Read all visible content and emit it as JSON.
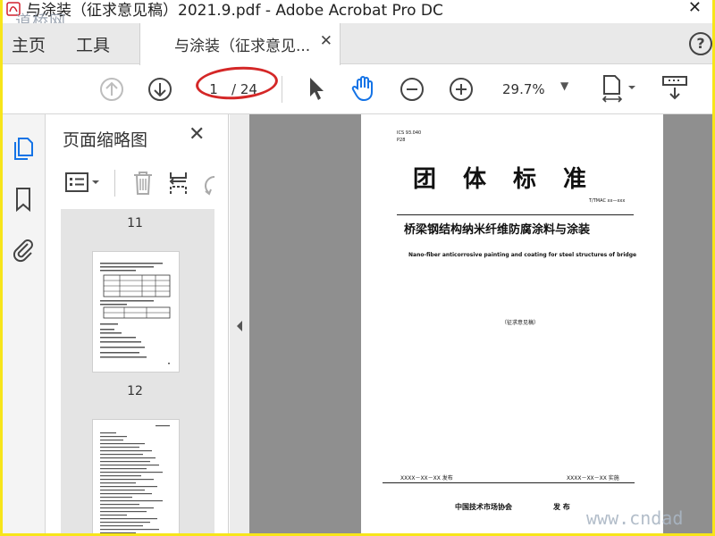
{
  "window": {
    "title": "与涂装（征求意见稿）2021.9.pdf - Adobe Acrobat Pro DC",
    "close_glyph": "✕",
    "watermark_top": "道桥网",
    "watermark_bottom": "www.cndad"
  },
  "tabs": {
    "home": "主页",
    "tools": "工具",
    "document": "与涂装（征求意见...",
    "close": "✕",
    "help": "?"
  },
  "toolbar": {
    "current_page": "1",
    "total_pages": "/ 24",
    "zoom": "29.7%",
    "zoom_caret": "▼"
  },
  "panel": {
    "title": "页面缩略图",
    "close": "✕",
    "thumbnails": [
      {
        "label": "11"
      },
      {
        "label": "12"
      }
    ]
  },
  "document": {
    "ics": "ICS 93.040",
    "pcode": "P28",
    "standard_type": "团体标准",
    "standard_no": "T/TMAC xx—xxx",
    "title_cn": "桥梁钢结构纳米纤维防腐涂料与涂装",
    "title_en": "Nano-fiber anticorrosive painting and coating for steel structures of bridge",
    "draft_note": "（征求意见稿）",
    "issue_date": "XXXX－XX－XX 发布",
    "implement_date": "XXXX－XX－XX 实施",
    "organization": "中国技术市场协会",
    "publish": "发 布"
  },
  "colors": {
    "accent": "#1473e6",
    "annotation_oval": "#d42727",
    "outer_frame": "#f7e51a",
    "document_area": "#8f8f8f"
  },
  "icons": [
    "acrobat-logo-icon",
    "arrow-up-icon",
    "arrow-down-icon",
    "select-cursor-icon",
    "hand-tool-icon",
    "zoom-out-icon",
    "zoom-in-icon",
    "fit-page-icon",
    "scroll-mode-icon",
    "page-thumbnails-icon",
    "bookmark-icon",
    "attachment-icon",
    "options-menu-icon",
    "delete-icon",
    "insert-pages-icon",
    "rotate-icon"
  ]
}
